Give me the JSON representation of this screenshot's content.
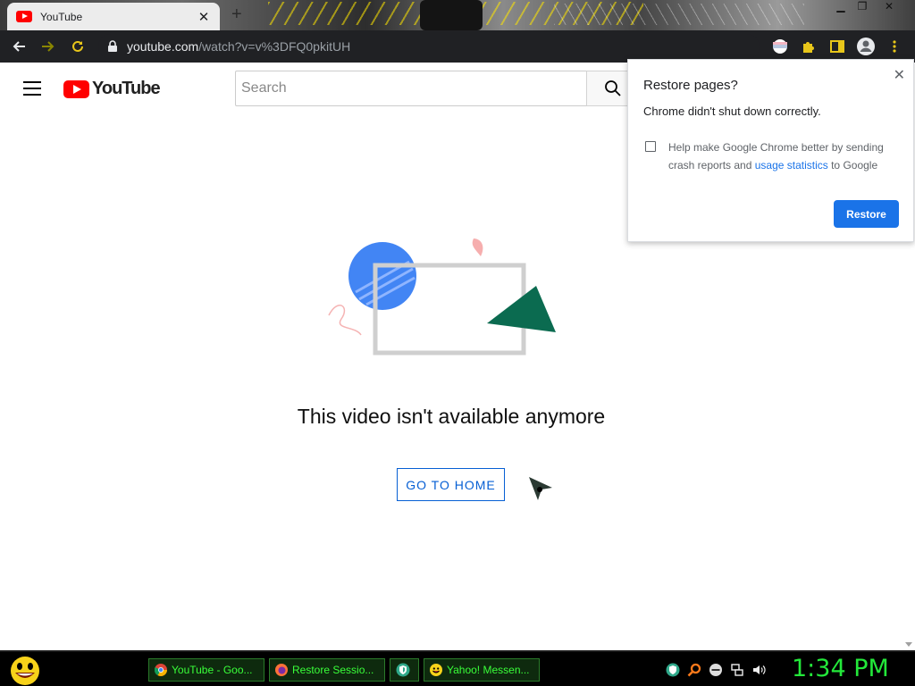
{
  "browser": {
    "tab": {
      "title": "YouTube"
    },
    "address": {
      "host": "youtube.com",
      "path": "/watch?v=v%3DFQ0pkitUH"
    }
  },
  "youtube": {
    "logo_text": "YouTube",
    "search_placeholder": "Search",
    "error_message": "This video isn't available anymore",
    "home_button": "GO TO HOME"
  },
  "restore_popup": {
    "title": "Restore pages?",
    "subtitle": "Chrome didn't shut down correctly.",
    "checkbox_checked": false,
    "help_prefix": "Help make Google Chrome better by sending crash reports and ",
    "help_link": "usage statistics",
    "help_suffix": " to Google",
    "restore_button": "Restore"
  },
  "taskbar": {
    "tasks": [
      {
        "label": "YouTube - Goo...",
        "icon": "chrome-icon"
      },
      {
        "label": "Restore Sessio...",
        "icon": "firefox-icon"
      },
      {
        "label": "",
        "icon": "shield-icon"
      },
      {
        "label": "Yahoo! Messen...",
        "icon": "smiley-icon"
      }
    ],
    "clock": "1:34 PM"
  },
  "colors": {
    "youtube_red": "#ff0000",
    "link_blue": "#065fd4",
    "chrome_blue": "#1a73e8",
    "taskbar_green": "#39ff39",
    "clock_green": "#23e83a"
  }
}
